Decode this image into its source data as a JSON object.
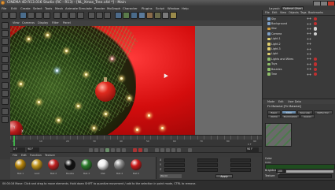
{
  "window": {
    "title": "CINEMA 4D R13.016 Studio (RC - R13) - [NL_Xmas_Tree.c4d *] - Main"
  },
  "menubar": {
    "items": [
      "File",
      "Edit",
      "Create",
      "Select",
      "Tools",
      "Mesh",
      "Animate",
      "Simulate",
      "Render",
      "MoGraph",
      "Character",
      "Plugins",
      "Script",
      "Window",
      "Help"
    ],
    "layout_label": "Layout:",
    "layout_value": "Optimal (User)"
  },
  "viewport": {
    "menu": [
      "View",
      "Cameras",
      "Display",
      "Filter",
      "Panel"
    ],
    "axis_y": "Y",
    "axis_x": "X"
  },
  "timeline": {
    "ticks": [
      "0",
      "10",
      "20",
      "30",
      "40",
      "50",
      "60",
      "70",
      "80",
      "90"
    ],
    "current_frame": "0 F",
    "end_frame": "90 F",
    "start_field": "0 F",
    "end_field": "90 F"
  },
  "material_manager": {
    "menu": [
      "File",
      "Edit",
      "Function",
      "Texture"
    ],
    "materials": [
      {
        "label": "Mat.1",
        "color": "#b8860b"
      },
      {
        "label": "Gold",
        "color": "#c0941a"
      },
      {
        "label": "Mat.2",
        "color": "#c02020"
      },
      {
        "label": "Bauble",
        "color": "#111111"
      },
      {
        "label": "Mat.3",
        "color": "#2a7a2a"
      },
      {
        "label": "Mat",
        "color": "#ededed"
      },
      {
        "label": "Mat.4",
        "color": "#8c8c8c"
      },
      {
        "label": "Mat.5",
        "color": "#cc1a1a"
      }
    ]
  },
  "coordinates": {
    "rows": [
      {
        "label": "X",
        "a": "0 cm",
        "b": "0 cm",
        "c": "0°"
      },
      {
        "label": "Y",
        "a": "0 cm",
        "b": "0 cm",
        "c": "0°"
      },
      {
        "label": "Z",
        "a": "0 cm",
        "b": "0 cm",
        "c": "0°"
      }
    ],
    "mode": "World",
    "apply": "Apply"
  },
  "object_manager": {
    "menu": [
      "File",
      "Edit",
      "View",
      "Objects",
      "Tags",
      "Bookmarks"
    ],
    "objects": [
      {
        "name": "Sky",
        "color": "#7fa2c9",
        "tag": "#c03030"
      },
      {
        "name": "Background",
        "color": "#7fa2c9",
        "tag": "#c03030"
      },
      {
        "name": "Star",
        "color": "#d9a33a",
        "tag": "#d0d0d0"
      },
      {
        "name": "Camera",
        "color": "#7fa2c9",
        "tag": "#d0d0d0"
      },
      {
        "name": "Light.1",
        "color": "#e0d070",
        "tag": ""
      },
      {
        "name": "Light.2",
        "color": "#e0d070",
        "tag": ""
      },
      {
        "name": "Light.3",
        "color": "#e0d070",
        "tag": ""
      },
      {
        "name": "Light",
        "color": "#e0d070",
        "tag": ""
      },
      {
        "name": "Lights and Wires",
        "color": "#8fbf6a",
        "tag": "#c03030"
      },
      {
        "name": "Toys",
        "color": "#8fbf6a",
        "tag": "#c03030"
      },
      {
        "name": "Baubles",
        "color": "#8fbf6a",
        "tag": "#c03030"
      },
      {
        "name": "Tree",
        "color": "#8fbf6a",
        "tag": "#c03030"
      }
    ]
  },
  "attributes": {
    "menu": [
      "Mode",
      "Edit",
      "User Data"
    ],
    "title": "Fir Material [Fir Material]",
    "tabs_row1": [
      "Basic",
      "Color",
      "Specular",
      "Reflection"
    ],
    "tabs_row2": [
      "Alpha",
      "Illumination",
      "Assign"
    ],
    "section": "Color",
    "color_label": "Color",
    "brightness_label": "Brightness",
    "brightness_value": "100 %",
    "brightness_level": 1.0,
    "texture_label": "Texture",
    "mix_label": "Mix Mode",
    "mix_value": "Normal",
    "texture_sub": "Mix Strength",
    "texture_sub_value": "100 %"
  },
  "status": {
    "text": "00:00:16  Move: Click and drag to move elements. Hold down SHIFT to quantize movement / add to the selection in point mode, CTRL to remove."
  }
}
